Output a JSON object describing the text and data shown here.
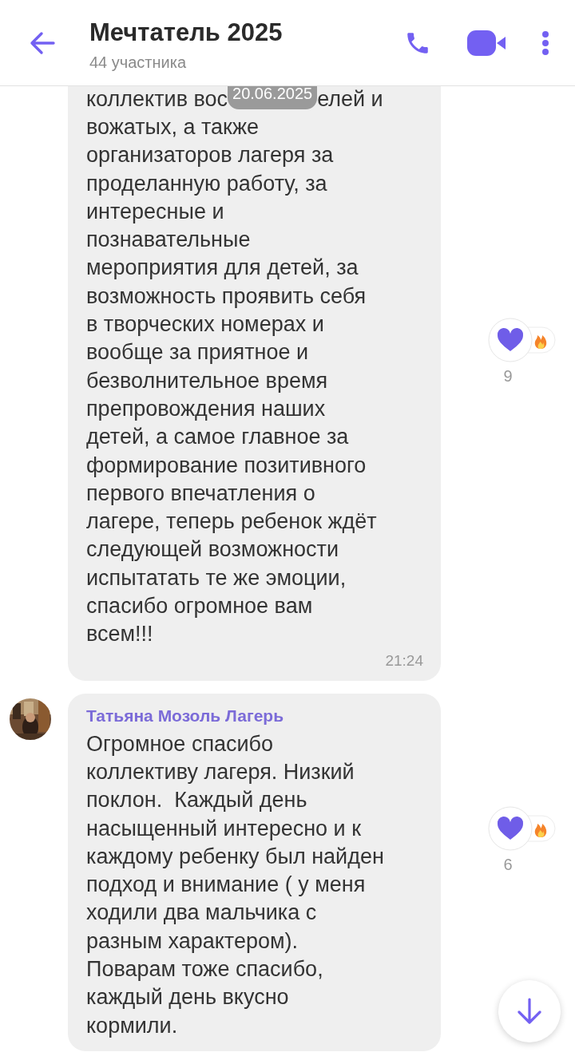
{
  "header": {
    "title": "Мечтатель 2025",
    "subtitle": "44 участника"
  },
  "date_badge": "20.06.2025",
  "messages": [
    {
      "first_line": [
        "коллектив вос",
        "елей и"
      ],
      "lines": [
        "вожатых, а также",
        "организаторов лагеря за",
        "проделанную работу, за",
        "интересные и",
        "познавательные",
        "мероприятия для детей, за",
        "возможность проявить себя",
        "в творческих номерах и",
        "вообще за приятное и",
        "безволнительное время",
        "препровождения наших",
        "детей, а самое главное за",
        "формирование позитивного",
        "первого впечатления о",
        "лагере, теперь ребенок ждёт",
        "следующей возможности",
        "испытатать те же эмоции,",
        "спасибо огромное вам",
        "всем!!!"
      ],
      "time": "21:24",
      "reactions": [
        {
          "kind": "heart"
        },
        {
          "kind": "fire"
        }
      ],
      "reaction_count": "9"
    },
    {
      "sender": "Татьяна Мозоль Лагерь",
      "lines": [
        "Огромное спасибо",
        "коллективу лагеря. Низкий",
        "поклон.  Каждый день",
        "насыщенный интересно и к",
        "каждому ребенку был найден",
        "подход и внимание ( у меня",
        "ходили два мальчика с",
        "разным характером).",
        "Поварам тоже спасибо,",
        "каждый день вкусно",
        "кормили."
      ],
      "reactions": [
        {
          "kind": "heart"
        },
        {
          "kind": "fire"
        }
      ],
      "reaction_count": "6"
    }
  ]
}
